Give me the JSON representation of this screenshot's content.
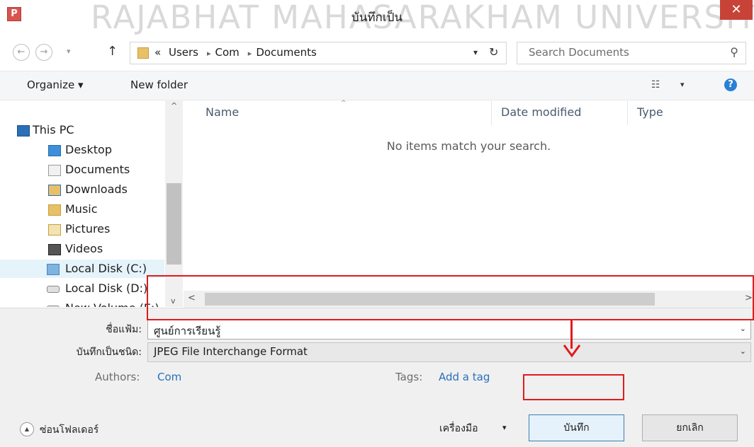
{
  "window": {
    "title": "บันทึกเป็น",
    "watermark": "RAJABHAT MAHASARAKHAM UNIVERSITY",
    "app_icon_letter": "P",
    "close_glyph": "✕"
  },
  "nav": {
    "back_icon": "←",
    "forward_icon": "→",
    "recent_icon": "▾",
    "up_icon": "↑"
  },
  "address": {
    "overflow": "«",
    "crumbs": [
      "Users",
      "Com",
      "Documents"
    ],
    "separator": "▸",
    "dropdown_icon": "▾",
    "refresh_icon": "↻"
  },
  "search": {
    "placeholder": "Search Documents",
    "icon": "⚲"
  },
  "toolbar": {
    "organize_label": "Organize ▾",
    "new_folder_label": "New folder",
    "view_icon": "☷",
    "view_dropdown": "▾",
    "help_icon": "?"
  },
  "sidebar": {
    "items": [
      {
        "label": "This PC"
      },
      {
        "label": "Desktop"
      },
      {
        "label": "Documents"
      },
      {
        "label": "Downloads"
      },
      {
        "label": "Music"
      },
      {
        "label": "Pictures"
      },
      {
        "label": "Videos"
      },
      {
        "label": "Local Disk (C:)"
      },
      {
        "label": "Local Disk (D:)"
      },
      {
        "label": "New Volume (E:)"
      }
    ]
  },
  "filelist": {
    "columns": {
      "name": "Name",
      "date": "Date modified",
      "type": "Type"
    },
    "sort_icon": "^",
    "empty_message": "No items match your search."
  },
  "scroll": {
    "up": "^",
    "down": "v",
    "left": "<",
    "right": ">"
  },
  "form": {
    "filename_label": "ชื่อแฟ้ม:",
    "filename_value": "ศูนย์การเรียนรู้",
    "filetype_label": "บันทึกเป็นชนิด:",
    "filetype_value": "JPEG File Interchange Format",
    "dropdown_icon": "⌄",
    "authors_label": "Authors:",
    "authors_value": "Com",
    "tags_label": "Tags:",
    "tags_value": "Add a tag"
  },
  "footer": {
    "hide_folders_icon": "▲",
    "hide_folders_label": "ซ่อนโฟลเดอร์",
    "tools_label": "เครื่องมือ",
    "tools_dropdown": "▾",
    "save_label": "บันทึก",
    "cancel_label": "ยกเลิก"
  },
  "annotation_color": "#e01b1b"
}
